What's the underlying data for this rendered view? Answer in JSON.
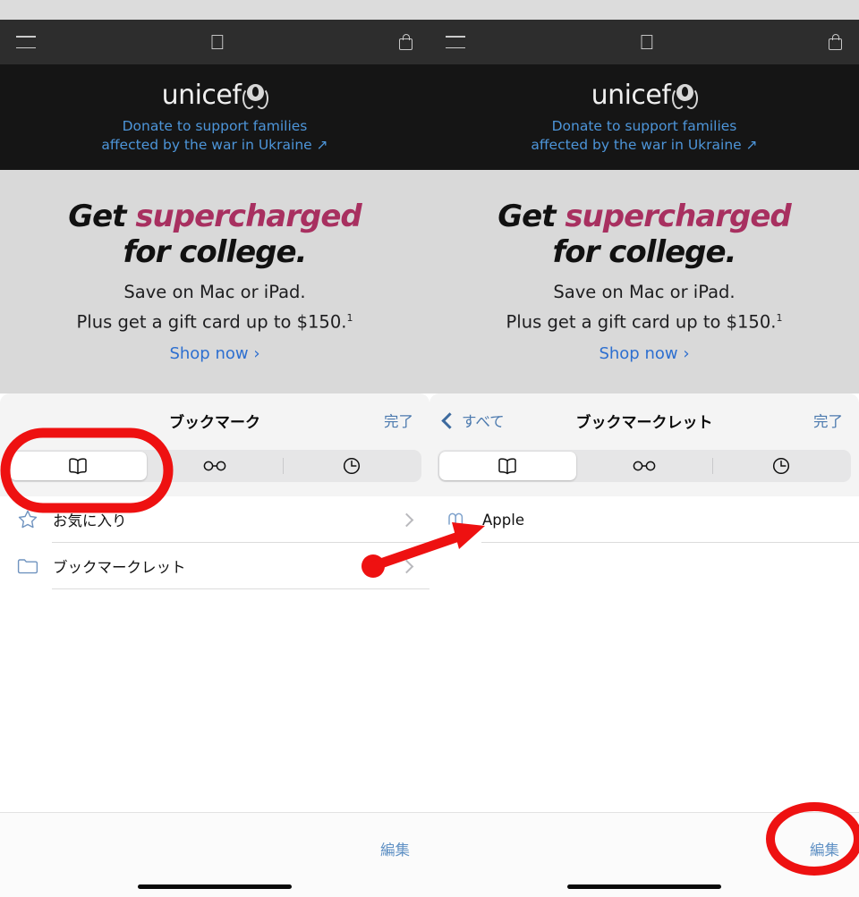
{
  "webpage": {
    "globalnav": {
      "menu_icon": "hamburger-icon",
      "logo_icon": "apple-logo-icon",
      "bag_icon": "shopping-bag-icon"
    },
    "unicef_banner": {
      "wordmark": "unicef",
      "emblem_icon": "unicef-emblem-icon",
      "line1": "Donate to support families",
      "line2": "affected by the war in Ukraine",
      "external_link_glyph": "↗",
      "link_color": "#4d95d9"
    },
    "hero": {
      "headline_part1": "Get ",
      "headline_accent": "supercharged",
      "headline_line2": "for college.",
      "accent_color": "#a83060",
      "sub_line1": "Save on Mac or iPad.",
      "sub_line2": "Plus get a gift card up to $150.",
      "sub_footnote": "1",
      "cta_label": "Shop now",
      "cta_glyph": "›",
      "cta_color": "#2d6fd0"
    }
  },
  "left_sheet": {
    "title": "ブックマーク",
    "done_label": "完了",
    "segments": [
      {
        "icon": "book-icon",
        "active": true
      },
      {
        "icon": "reading-glasses-icon",
        "active": false
      },
      {
        "icon": "clock-history-icon",
        "active": false
      }
    ],
    "rows": [
      {
        "icon": "star-outline-icon",
        "label": "お気に入り",
        "chevron": "›"
      },
      {
        "icon": "folder-outline-icon",
        "label": "ブックマークレット",
        "chevron": "›"
      }
    ],
    "toolbar": {
      "edit_label": "編集"
    }
  },
  "right_sheet": {
    "back_label": "すべて",
    "back_icon": "chevron-left-icon",
    "title": "ブックマークレット",
    "done_label": "完了",
    "segments": [
      {
        "icon": "book-icon",
        "active": true
      },
      {
        "icon": "reading-glasses-icon",
        "active": false
      },
      {
        "icon": "clock-history-icon",
        "active": false
      }
    ],
    "rows": [
      {
        "icon": "bookmarklet-icon",
        "label": "Apple"
      }
    ],
    "toolbar": {
      "edit_label": "編集"
    }
  },
  "annotations": {
    "color": "#ee1111",
    "highlight_left_segment": "red-rounded-rect-around-book-segment",
    "arrow": "red-arrow-from-bookmarklet-row-to-apple-row",
    "highlight_right_edit": "red-ellipse-around-edit-button"
  }
}
